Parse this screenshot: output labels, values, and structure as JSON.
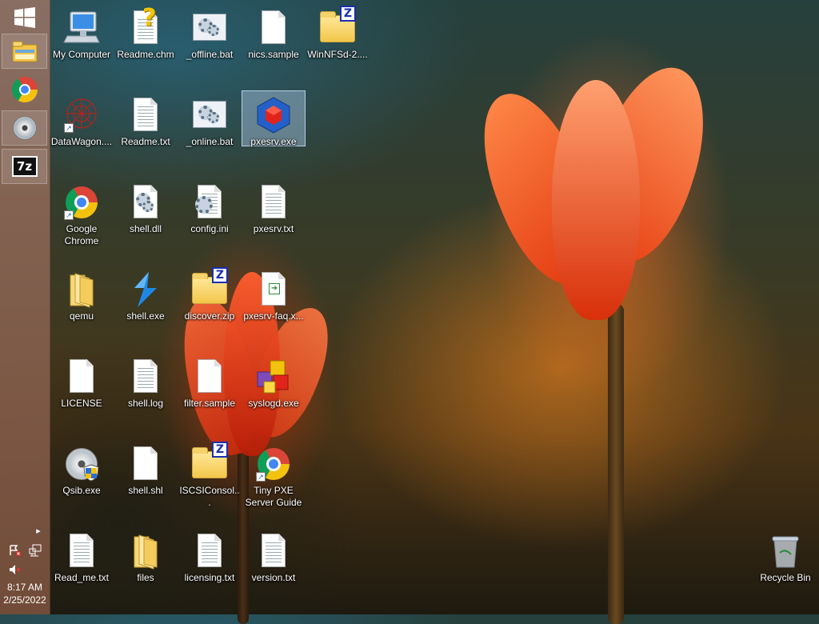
{
  "taskbar": {
    "start_icon": "windows-logo-icon",
    "pinned": [
      {
        "icon": "file-explorer-icon"
      },
      {
        "icon": "chrome-icon"
      },
      {
        "icon": "cd-drive-icon"
      },
      {
        "icon": "7zip-icon",
        "text": "7z"
      }
    ],
    "tray": {
      "expand_icon": "chevron-right-icon",
      "icons": [
        "action-center-error-icon",
        "network-icon",
        "volume-muted-icon"
      ],
      "time": "8:17 AM",
      "date": "2/25/2022"
    }
  },
  "desktop": {
    "icons": [
      {
        "label": "My Computer",
        "type": "computer"
      },
      {
        "label": "Readme.chm",
        "type": "help"
      },
      {
        "label": "_offline.bat",
        "type": "bat"
      },
      {
        "label": "nics.sample",
        "type": "blank"
      },
      {
        "label": "WinNFSd-2....",
        "type": "zipfolder"
      },
      {
        "label": "DataWagon....",
        "type": "datawagon"
      },
      {
        "label": "Readme.txt",
        "type": "txt"
      },
      {
        "label": "_online.bat",
        "type": "bat"
      },
      {
        "label": "pxesrv.exe",
        "type": "pxesrv"
      },
      {
        "label": "Google Chrome",
        "type": "chrome"
      },
      {
        "label": "shell.dll",
        "type": "dll"
      },
      {
        "label": "config.ini",
        "type": "ini"
      },
      {
        "label": "pxesrv.txt",
        "type": "txt"
      },
      {
        "label": "qemu",
        "type": "folder"
      },
      {
        "label": "shell.exe",
        "type": "shellexe"
      },
      {
        "label": "discover.zip",
        "type": "zipfolder"
      },
      {
        "label": "pxesrv-faq.x...",
        "type": "xdoc"
      },
      {
        "label": "LICENSE",
        "type": "blank"
      },
      {
        "label": "shell.log",
        "type": "txt"
      },
      {
        "label": "filter.sample",
        "type": "blank"
      },
      {
        "label": "syslogd.exe",
        "type": "syslogd"
      },
      {
        "label": "Qsib.exe",
        "type": "qsib"
      },
      {
        "label": "shell.shl",
        "type": "blank"
      },
      {
        "label": "ISCSIConsol...",
        "type": "zipfolder"
      },
      {
        "label": "Tiny PXE Server Guide",
        "type": "chrome"
      },
      {
        "label": "Read_me.txt",
        "type": "txt"
      },
      {
        "label": "files",
        "type": "folder"
      },
      {
        "label": "licensing.txt",
        "type": "txt"
      },
      {
        "label": "version.txt",
        "type": "txt"
      },
      {
        "label": "Recycle Bin",
        "type": "recycle"
      }
    ]
  },
  "colors": {
    "selection": "#aac8e6",
    "taskbar": "#96735f",
    "zip_badge": "#1a2fb0"
  }
}
